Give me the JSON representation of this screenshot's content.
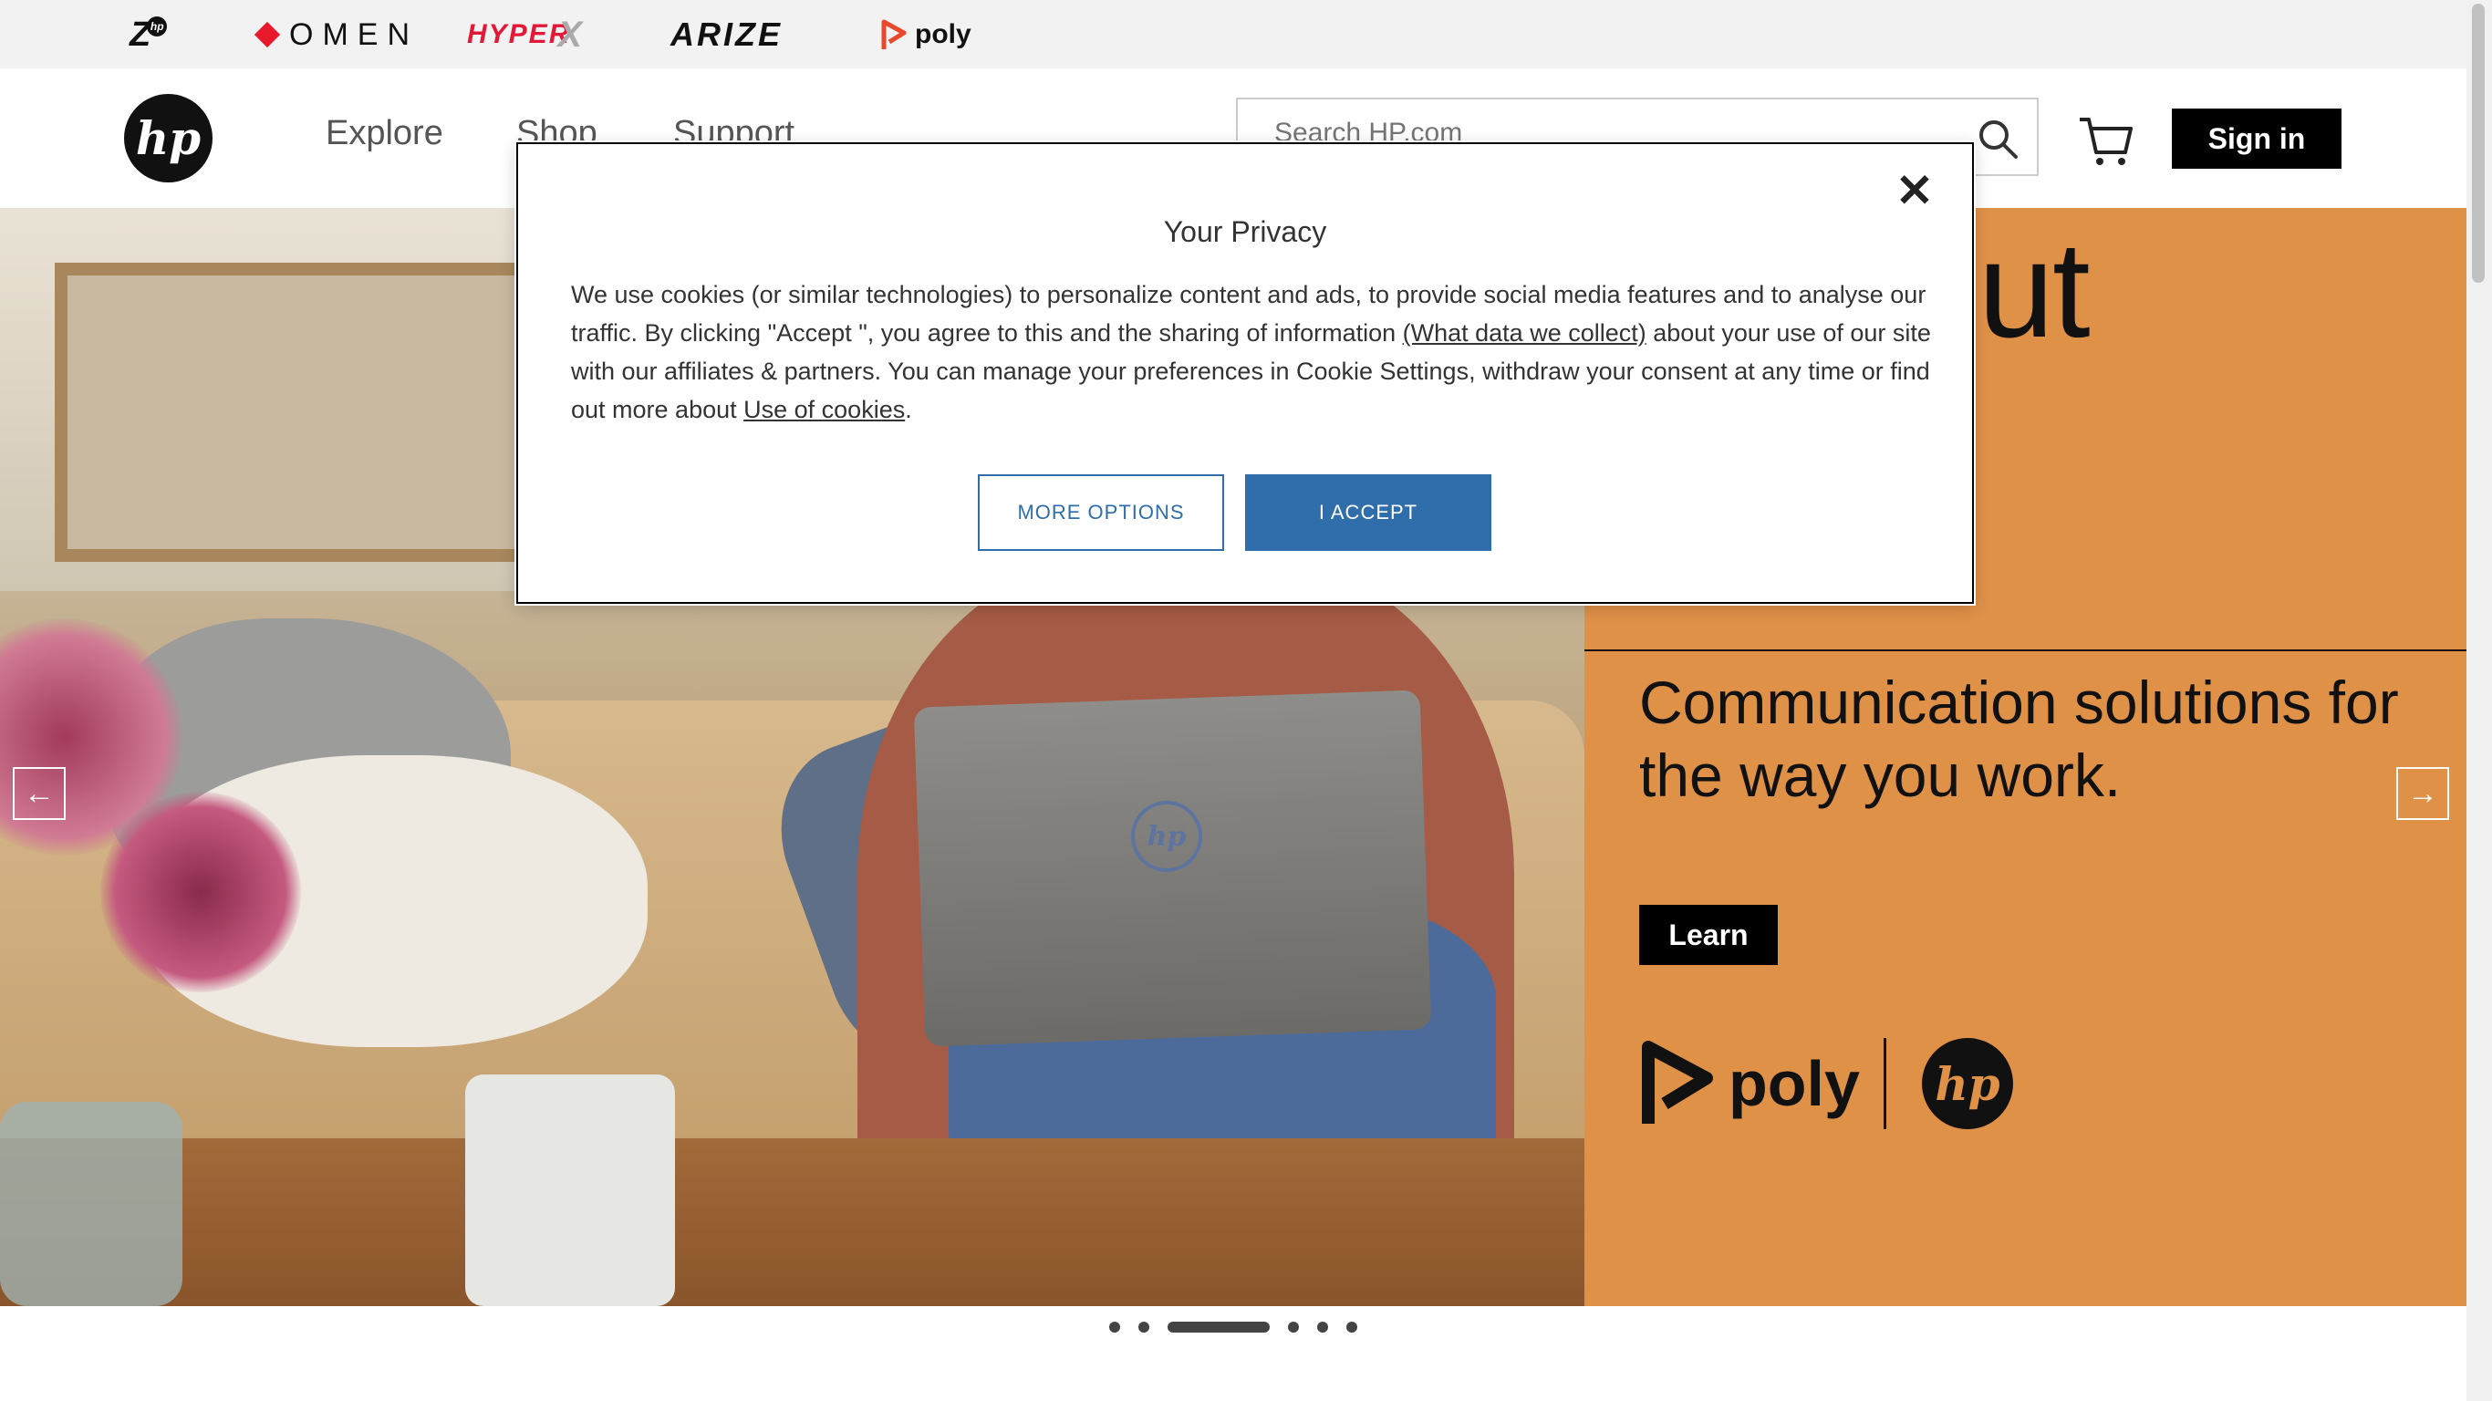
{
  "brand_bar": {
    "z_label": "Z",
    "z_badge": "hp",
    "omen_label": "OMEN",
    "hyperx_label": "HYPER",
    "hyperx_x": "X",
    "arize_label": "ARIZE",
    "poly_label": "poly"
  },
  "header": {
    "logo_text": "hp",
    "nav": [
      "Explore",
      "Shop",
      "Support"
    ],
    "search_placeholder": "Search HP.com",
    "sign_in_label": "Sign in"
  },
  "hero": {
    "heading_big": "orate ut",
    "subheading": "Communication solutions for the way you work.",
    "learn_label": "Learn",
    "poly_logo_text": "poly",
    "hp_logo_text": "hp",
    "laptop_logo_text": "hp",
    "prev_arrow": "←",
    "next_arrow": "→",
    "background_color": "#e09148"
  },
  "carousel": {
    "slide_count": 6,
    "active_index": 2
  },
  "privacy_dialog": {
    "title": "Your Privacy",
    "close_label": "✕",
    "body_part1": "We use cookies (or similar technologies) to personalize content and ads, to provide social media features and to analyse our traffic. By clicking \"Accept \", you agree to this and the sharing of information ",
    "what_data_link": "(What data we collect)",
    "body_part2": " about your use of our site with our affiliates & partners. You can manage your preferences in Cookie Settings, withdraw your consent at any time or find out more about ",
    "use_of_cookies_link": "Use of cookies",
    "body_end": ".",
    "more_options_label": "MORE OPTIONS",
    "accept_label": "I ACCEPT",
    "accent_color": "#2f6eab"
  }
}
